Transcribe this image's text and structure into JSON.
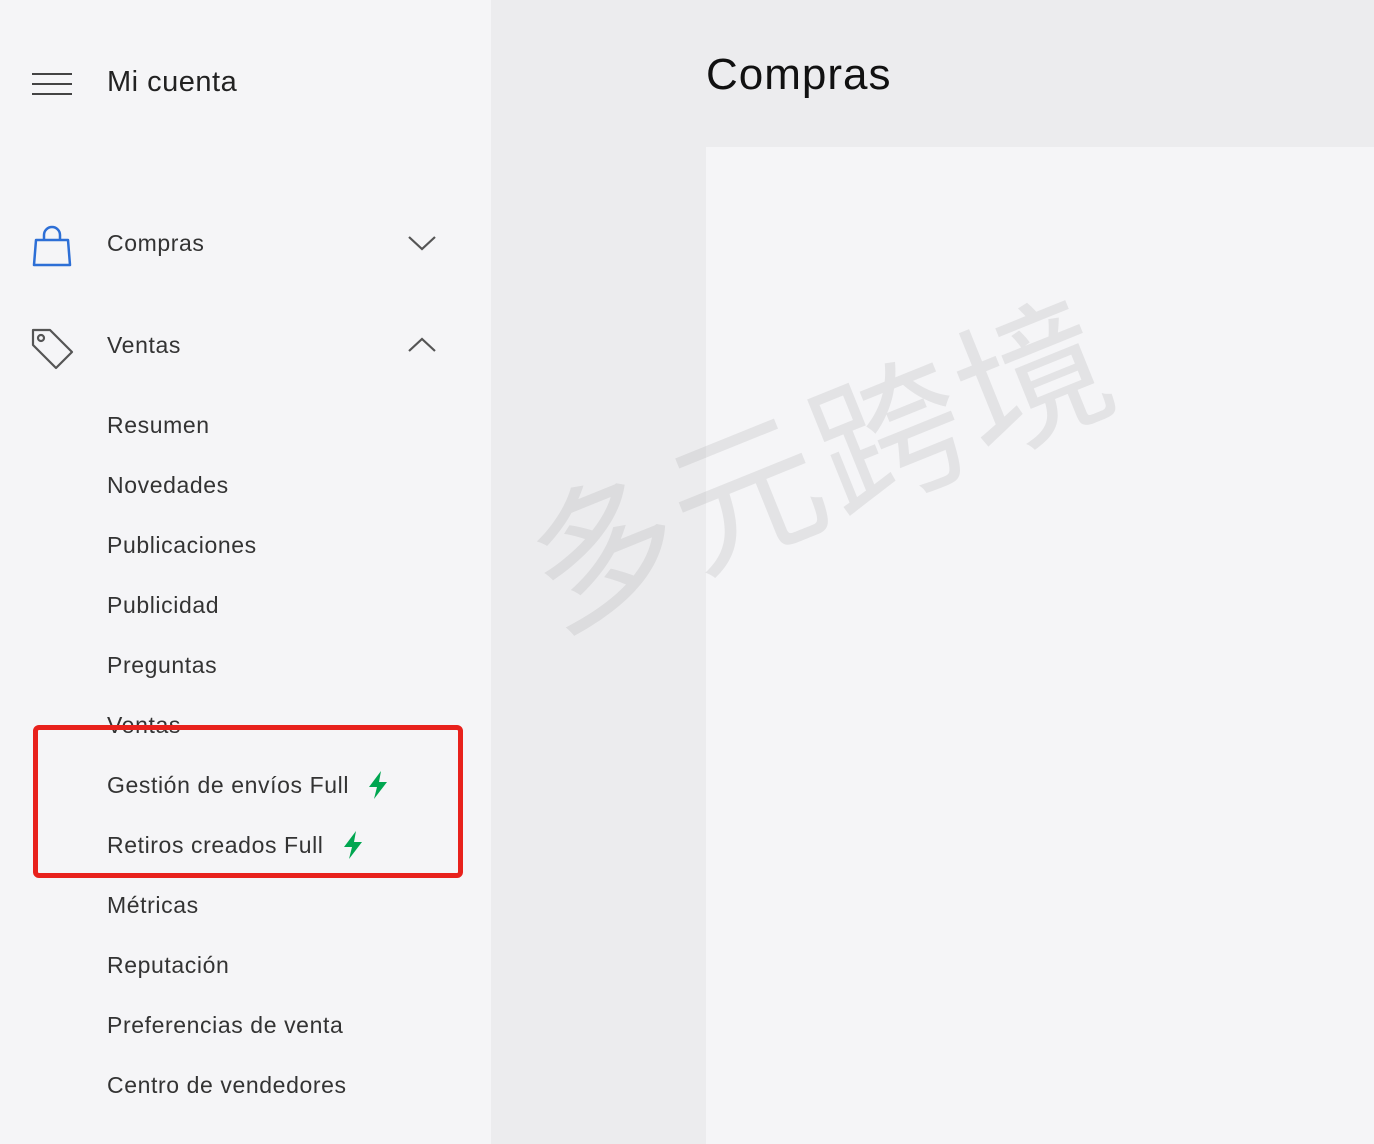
{
  "sidebar": {
    "title": "Mi cuenta",
    "menu_icon": "hamburger-menu-icon",
    "sections": [
      {
        "label": "Compras",
        "icon": "shopping-bag-icon",
        "expanded": false,
        "icon_color": "#2d6fd6"
      },
      {
        "label": "Ventas",
        "icon": "price-tag-icon",
        "expanded": true,
        "icon_color": "#444444"
      }
    ],
    "ventas_items": [
      {
        "label": "Resumen"
      },
      {
        "label": "Novedades"
      },
      {
        "label": "Publicaciones"
      },
      {
        "label": "Publicidad"
      },
      {
        "label": "Preguntas"
      },
      {
        "label": "Ventas"
      },
      {
        "label": "Gestión de envíos Full",
        "badge": "lightning-bolt-icon"
      },
      {
        "label": "Retiros creados Full",
        "badge": "lightning-bolt-icon"
      },
      {
        "label": "Métricas"
      },
      {
        "label": "Reputación"
      },
      {
        "label": "Preferencias de venta"
      },
      {
        "label": "Centro de vendedores"
      }
    ]
  },
  "main": {
    "title": "Compras"
  },
  "overlay": {
    "watermark": "多元跨境",
    "highlight_color": "#e8211c",
    "bolt_color": "#00a650"
  }
}
